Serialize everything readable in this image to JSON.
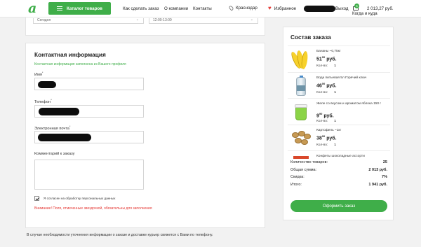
{
  "header": {
    "catalog_label": "Каталог товаров",
    "nav": [
      "Как сделать заказ",
      "О компании",
      "Контакты"
    ],
    "city": "Краснодар",
    "favorites": "Избранное",
    "logout": "Выход",
    "cart_count": "5",
    "cart_sum": "2 013,27 руб.",
    "cart_delivery": "Когда и куда",
    "colors": {
      "brand": "#3fae49",
      "heart": "#e53935"
    },
    "icons": [
      "logo-icon",
      "menu-icon",
      "location-pin-icon",
      "heart-icon",
      "cart-icon"
    ]
  },
  "delivery": {
    "day_value": "Сегодня",
    "time_value": "12:00-13:00"
  },
  "contact": {
    "title": "Контактная информация",
    "hint": "Контактная информация заполнена из Вашего профиля",
    "name_label": "Имя",
    "phone_label": "Телефон",
    "email_label": "Электронная почта",
    "comment_label": "Комментарий к заказу",
    "required_mark": "*",
    "agree_label": "Я согласен на обработку персональных данных",
    "warning": "Внимание! Поля, отмеченные звездочкой, обязательны для заполнения"
  },
  "bottom_note": "В случае необходимости уточнения информации о заказе и доставке курьер свяжется с Вами по телефону.",
  "order": {
    "title": "Состав заказа",
    "qty_label": "Кол-во:",
    "currency": "руб.",
    "items": [
      {
        "name": "Бананы ~0,75кг",
        "price_int": "51",
        "price_cents": "00",
        "qty": "1"
      },
      {
        "name": "Вода питьевая 5л Горячий ключ",
        "price_int": "46",
        "price_cents": "00",
        "qty": "1"
      },
      {
        "name": "Желе со вкусом и ароматом яблока 150 г",
        "price_int": "9",
        "price_cents": "90",
        "qty": "1"
      },
      {
        "name": "Картофель ~1кг",
        "price_int": "38",
        "price_cents": "00",
        "qty": "1"
      },
      {
        "name": "Конфеты шоколадные ассорти",
        "price_int": "",
        "price_cents": "",
        "qty": ""
      }
    ],
    "summary": [
      {
        "label": "Количество товаров:",
        "value": "25"
      },
      {
        "label": "Общая сумма:",
        "value": "2 013 руб."
      },
      {
        "label": "Скидка:",
        "value": "7%"
      },
      {
        "label": "Итого:",
        "value": "1 941 руб."
      }
    ],
    "submit_label": "Оформить заказ"
  }
}
